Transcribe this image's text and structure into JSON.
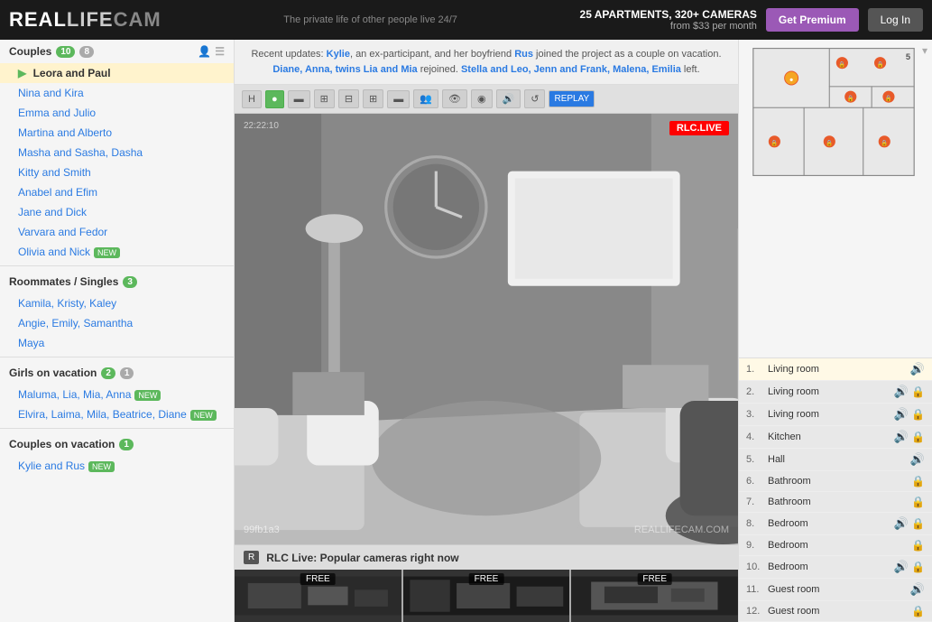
{
  "header": {
    "logo_real": "REAL",
    "logo_life": "LIFE",
    "logo_cam": "CAM",
    "tagline": "The private life of other people live 24/7",
    "apartments": "25 APARTMENTS, 320+ CAMERAS",
    "price": "from $33 per month",
    "btn_premium": "Get Premium",
    "btn_login": "Log In"
  },
  "notification": {
    "text1": "Recent updates: ",
    "name1": "Kylie",
    "text2": ", an ex-participant, and her boyfriend ",
    "name2": "Rus",
    "text3": " joined the project as a couple on vacation. ",
    "name3": "Diane, Anna, twins Lia and Mia",
    "text4": " rejoined. ",
    "name4": "Stella and Leo, Jenn and Frank, Malena, Emilia",
    "text5": " left."
  },
  "sidebar": {
    "couples_label": "Couples",
    "couples_count": "10",
    "couples_count2": "8",
    "couples": [
      {
        "name": "Leora and Paul",
        "active": true
      },
      {
        "name": "Nina and Kira",
        "active": false
      },
      {
        "name": "Emma and Julio",
        "active": false
      },
      {
        "name": "Martina and Alberto",
        "active": false
      },
      {
        "name": "Masha and Sasha, Dasha",
        "active": false
      },
      {
        "name": "Kitty and Smith",
        "active": false
      },
      {
        "name": "Anabel and Efim",
        "active": false
      },
      {
        "name": "Jane and Dick",
        "active": false
      },
      {
        "name": "Varvara and Fedor",
        "active": false
      },
      {
        "name": "Olivia and Nick",
        "active": false,
        "new": true
      }
    ],
    "roommates_label": "Roommates / Singles",
    "roommates_count": "3",
    "roommates": [
      {
        "name": "Kamila, Kristy, Kaley"
      },
      {
        "name": "Angie, Emily, Samantha"
      },
      {
        "name": "Maya"
      }
    ],
    "girls_label": "Girls on vacation",
    "girls_count1": "2",
    "girls_count2": "1",
    "girls": [
      {
        "name": "Maluma, Lia, Mia, Anna",
        "new": true
      },
      {
        "name": "Elvira, Laima, Mila, Beatrice, Diane",
        "new": true
      }
    ],
    "couples_vac_label": "Couples on vacation",
    "couples_vac_count": "1",
    "couples_vac": [
      {
        "name": "Kylie and Rus",
        "new": true
      }
    ]
  },
  "camera": {
    "timestamp": "22:22:10",
    "live_badge": "RLC.LIVE",
    "cam_id": "99fb1a3",
    "watermark": "REALLIFECAM.COM"
  },
  "rooms": [
    {
      "num": "1.",
      "name": "Living room",
      "active": true,
      "sound": true,
      "lock": false
    },
    {
      "num": "2.",
      "name": "Living room",
      "active": false,
      "sound": true,
      "lock": true
    },
    {
      "num": "3.",
      "name": "Living room",
      "active": false,
      "sound": true,
      "lock": true
    },
    {
      "num": "4.",
      "name": "Kitchen",
      "active": false,
      "sound": true,
      "lock": true
    },
    {
      "num": "5.",
      "name": "Hall",
      "active": false,
      "sound": true,
      "lock": false
    },
    {
      "num": "6.",
      "name": "Bathroom",
      "active": false,
      "sound": false,
      "lock": true
    },
    {
      "num": "7.",
      "name": "Bathroom",
      "active": false,
      "sound": false,
      "lock": true
    },
    {
      "num": "8.",
      "name": "Bedroom",
      "active": false,
      "sound": true,
      "lock": true
    },
    {
      "num": "9.",
      "name": "Bedroom",
      "active": false,
      "sound": false,
      "lock": true
    },
    {
      "num": "10.",
      "name": "Bedroom",
      "active": false,
      "sound": true,
      "lock": true
    },
    {
      "num": "11.",
      "name": "Guest room",
      "active": false,
      "sound": true,
      "lock": false
    },
    {
      "num": "12.",
      "name": "Guest room",
      "active": false,
      "sound": false,
      "lock": true
    }
  ],
  "bottom": {
    "rlc_label": "R",
    "title": "RLC Live: Popular cameras right now"
  },
  "thumbs": [
    {
      "label": "FREE"
    },
    {
      "label": "FREE"
    },
    {
      "label": "FREE"
    }
  ]
}
